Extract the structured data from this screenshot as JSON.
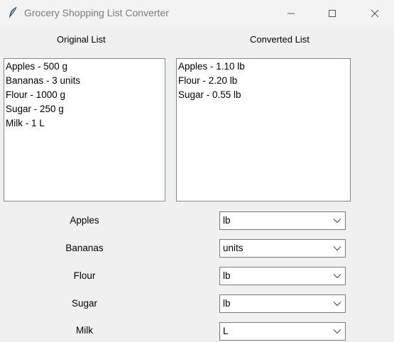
{
  "window": {
    "title": "Grocery Shopping List Converter"
  },
  "headers": {
    "original": "Original List",
    "converted": "Converted List"
  },
  "original_list": [
    "Apples - 500 g",
    "Bananas - 3 units",
    "Flour - 1000 g",
    "Sugar - 250 g",
    "Milk - 1 L"
  ],
  "converted_list": [
    "Apples - 1.10 lb",
    "Flour - 2.20 lb",
    "Sugar - 0.55 lb"
  ],
  "units": [
    {
      "label": "Apples",
      "selected": "lb"
    },
    {
      "label": "Bananas",
      "selected": "units"
    },
    {
      "label": "Flour",
      "selected": "lb"
    },
    {
      "label": "Sugar",
      "selected": "lb"
    },
    {
      "label": "Milk",
      "selected": "L"
    }
  ],
  "icons": {
    "app": "feather-icon",
    "minimize": "minimize-icon",
    "maximize": "maximize-icon",
    "close": "close-icon",
    "dropdown": "chevron-down-icon"
  }
}
